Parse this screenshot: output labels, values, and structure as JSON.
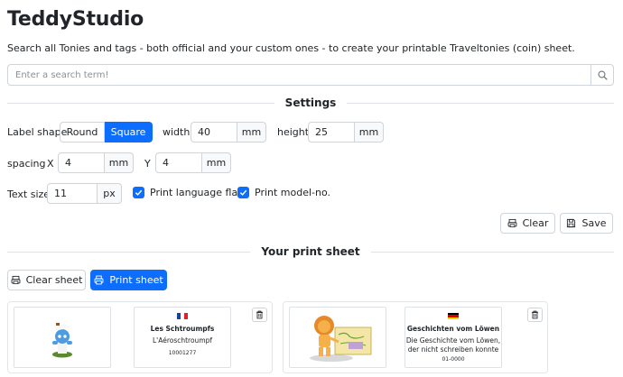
{
  "app": {
    "title": "TeddyStudio",
    "subtitle": "Search all Tonies and tags - both official and your custom ones - to create your printable Traveltonies (coin) sheet."
  },
  "search": {
    "placeholder": "Enter a search term!",
    "icon": "search-icon"
  },
  "settings": {
    "heading": "Settings",
    "label_shape": {
      "label": "Label shape",
      "options": [
        "Round",
        "Square"
      ],
      "selected": "Square"
    },
    "width": {
      "label": "width",
      "value": "40",
      "unit": "mm"
    },
    "height": {
      "label": "height",
      "value": "25",
      "unit": "mm"
    },
    "spacing": {
      "label": "spacing",
      "x_label": "X",
      "x_value": "4",
      "x_unit": "mm",
      "y_label": "Y",
      "y_value": "4",
      "y_unit": "mm"
    },
    "text_size": {
      "label": "Text size",
      "value": "11",
      "unit": "px"
    },
    "print_language_flag": {
      "label": "Print language flag",
      "checked": true
    },
    "print_model_no": {
      "label": "Print model-no.",
      "checked": true
    },
    "clear_label": "Clear",
    "save_label": "Save"
  },
  "print_sheet": {
    "heading": "Your print sheet",
    "clear_sheet_label": "Clear sheet",
    "print_sheet_label": "Print sheet",
    "items": [
      {
        "language": "fr",
        "title": "Les Schtroumpfs",
        "subtitle": "L'Aéroschtroumpf",
        "model_no": "10001277"
      },
      {
        "language": "de",
        "title": "Geschichten vom Löwen",
        "subtitle": "Die Geschichte vom Löwen, der nicht schreiben konnte",
        "model_no": "01-0000"
      }
    ]
  },
  "colors": {
    "primary": "#0d6efd",
    "border": "#ced4da",
    "text": "#212529"
  }
}
